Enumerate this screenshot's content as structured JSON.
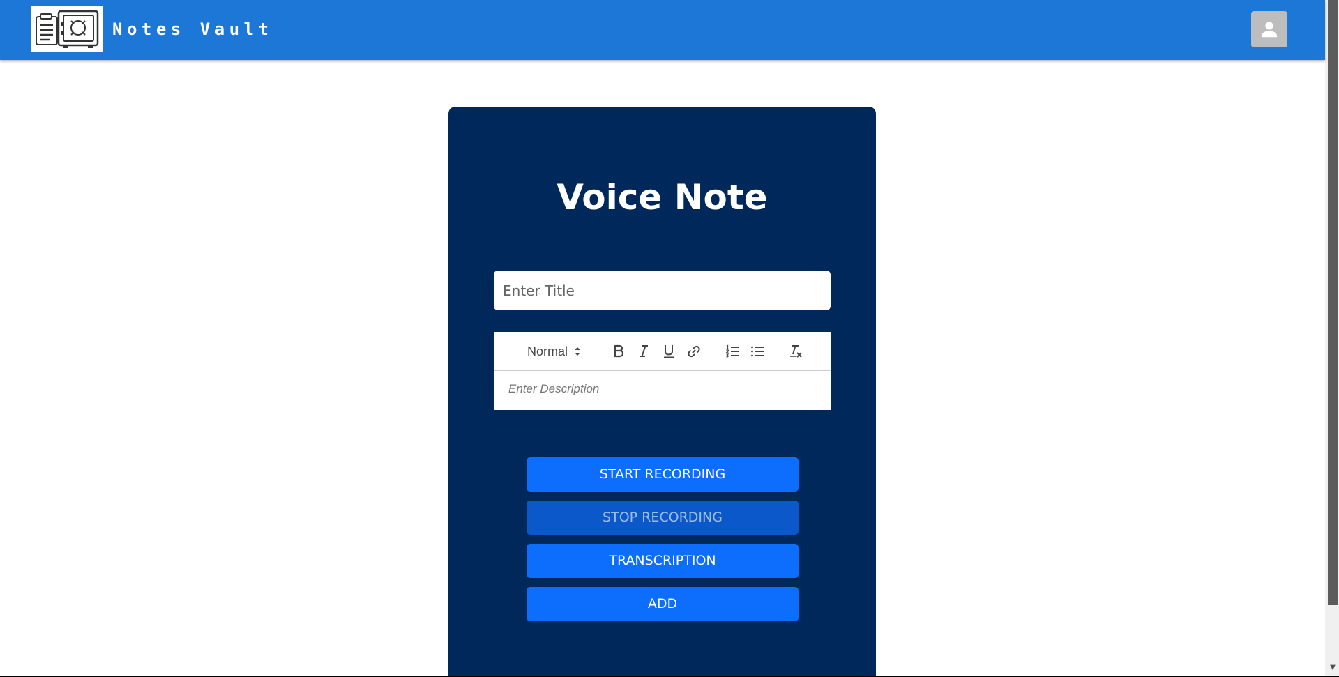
{
  "header": {
    "brand_title": "Notes Vault",
    "logo_icon": "notes-vault-logo",
    "avatar_icon": "user-account-icon",
    "bar_color": "#1c77d6"
  },
  "form": {
    "heading": "Voice Note",
    "title_placeholder": "Enter Title",
    "card_color": "#00285a"
  },
  "editor": {
    "format_select_value": "Normal",
    "description_placeholder": "Enter Description",
    "tools": [
      "bold-icon",
      "italic-icon",
      "underline-icon",
      "link-icon",
      "ordered-list-icon",
      "bullet-list-icon",
      "clear-format-icon"
    ]
  },
  "actions": {
    "start_label": "START RECORDING",
    "stop_label": "STOP RECORDING",
    "transcription_label": "TRANSCRIPTION",
    "add_label": "ADD",
    "button_color": "#0d6efd"
  }
}
